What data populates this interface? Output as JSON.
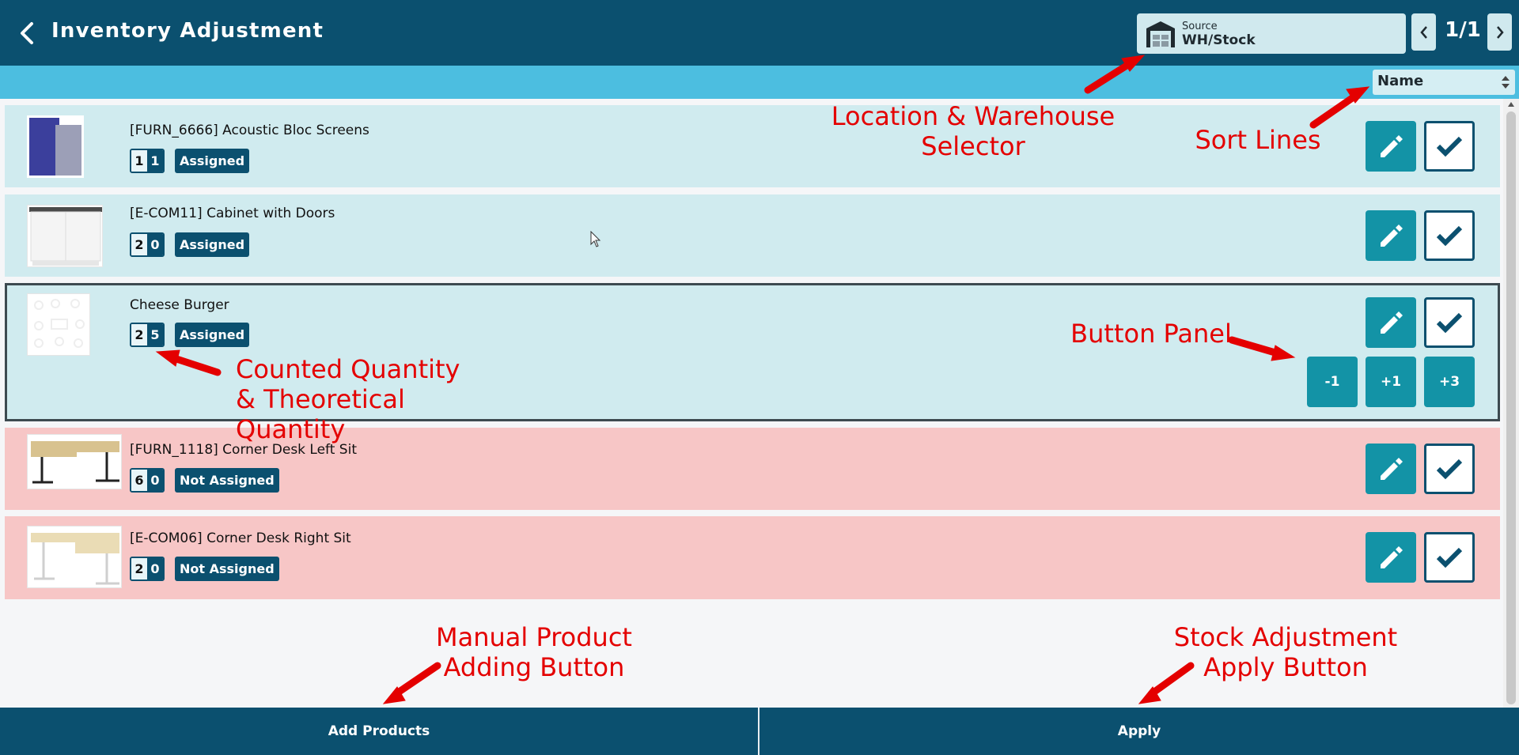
{
  "header": {
    "title": "Inventory Adjustment",
    "source_label": "Source",
    "source_value": "WH/Stock",
    "pager": "1/1"
  },
  "sort": {
    "selected": "Name"
  },
  "rows": [
    {
      "name": "[FURN_6666] Acoustic Bloc Screens",
      "counted": "1",
      "theoretical": "1",
      "status": "Assigned"
    },
    {
      "name": "[E-COM11] Cabinet with Doors",
      "counted": "2",
      "theoretical": "0",
      "status": "Assigned"
    },
    {
      "name": "Cheese Burger",
      "counted": "2",
      "theoretical": "5",
      "status": "Assigned",
      "buttons": [
        "-1",
        "+1",
        "+3"
      ]
    },
    {
      "name": "[FURN_1118] Corner Desk Left Sit",
      "counted": "6",
      "theoretical": "0",
      "status": "Not Assigned"
    },
    {
      "name": "[E-COM06] Corner Desk Right Sit",
      "counted": "2",
      "theoretical": "0",
      "status": "Not Assigned"
    }
  ],
  "footer": {
    "add_label": "Add Products",
    "apply_label": "Apply"
  },
  "annotations": {
    "location": "Location & Warehouse Selector",
    "sort": "Sort Lines",
    "button_panel": "Button Panel",
    "quantity": "Counted Quantity & Theoretical Quantity",
    "manual_add": "Manual Product Adding Button",
    "apply": "Stock Adjustment Apply Button"
  },
  "colors": {
    "header": "#0b506f",
    "subbar": "#4cbee0",
    "assigned_row": "#d0ebef",
    "unassigned_row": "#f7c6c6",
    "action_button": "#1393a6",
    "annotation": "#e40000"
  },
  "icons": {
    "back": "chevron-left-icon",
    "warehouse": "warehouse-icon",
    "edit": "pencil-icon",
    "validate": "checkmark-icon"
  }
}
